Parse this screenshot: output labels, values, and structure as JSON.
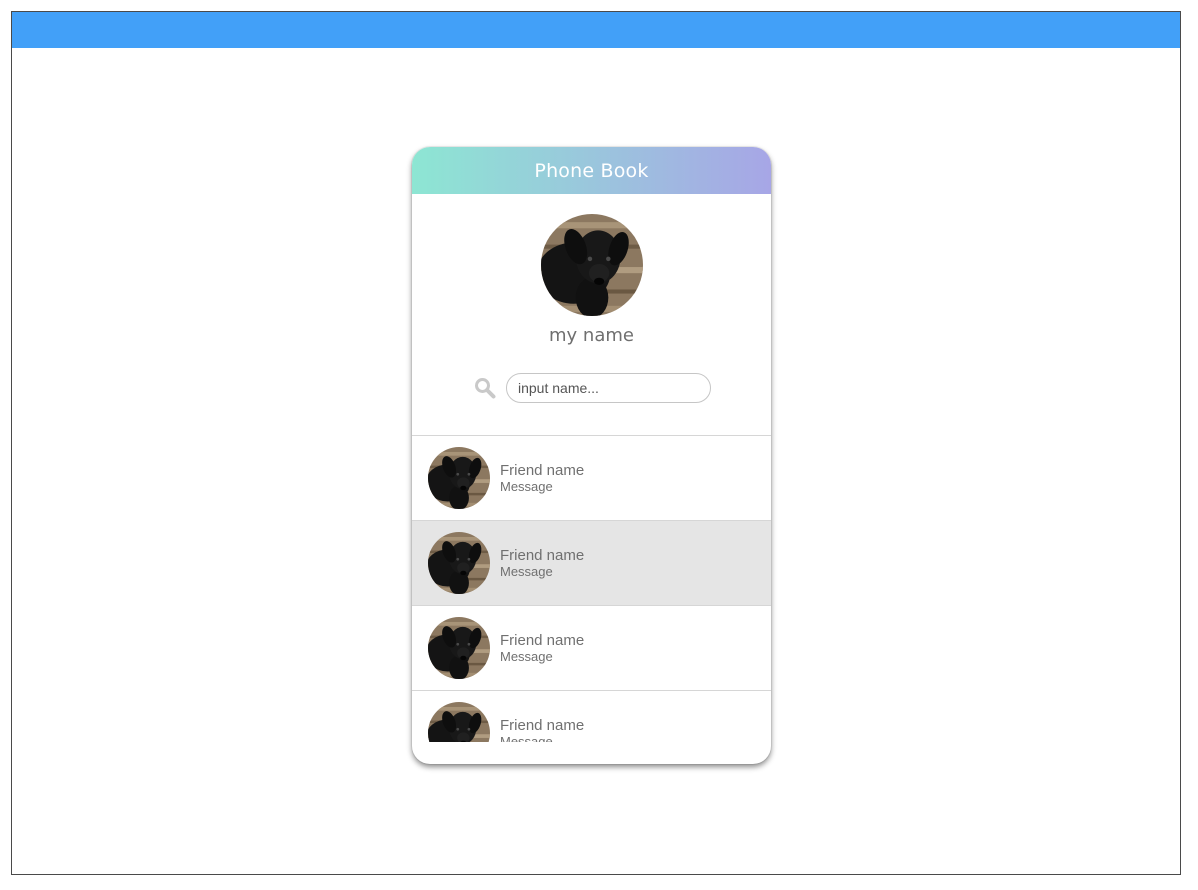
{
  "app": {
    "title": "Phone Book",
    "accent_color": "#42a0f8",
    "header_gradient": [
      "#8de6d3",
      "#a7a6e6"
    ]
  },
  "profile": {
    "name": "my name",
    "avatar_icon": "black-dog-photo"
  },
  "search": {
    "icon": "search-icon",
    "placeholder": "input name...",
    "value": ""
  },
  "friends": [
    {
      "name": "Friend name",
      "message": "Message",
      "selected": false
    },
    {
      "name": "Friend name",
      "message": "Message",
      "selected": true
    },
    {
      "name": "Friend name",
      "message": "Message",
      "selected": false
    },
    {
      "name": "Friend name",
      "message": "Message",
      "selected": false
    }
  ]
}
